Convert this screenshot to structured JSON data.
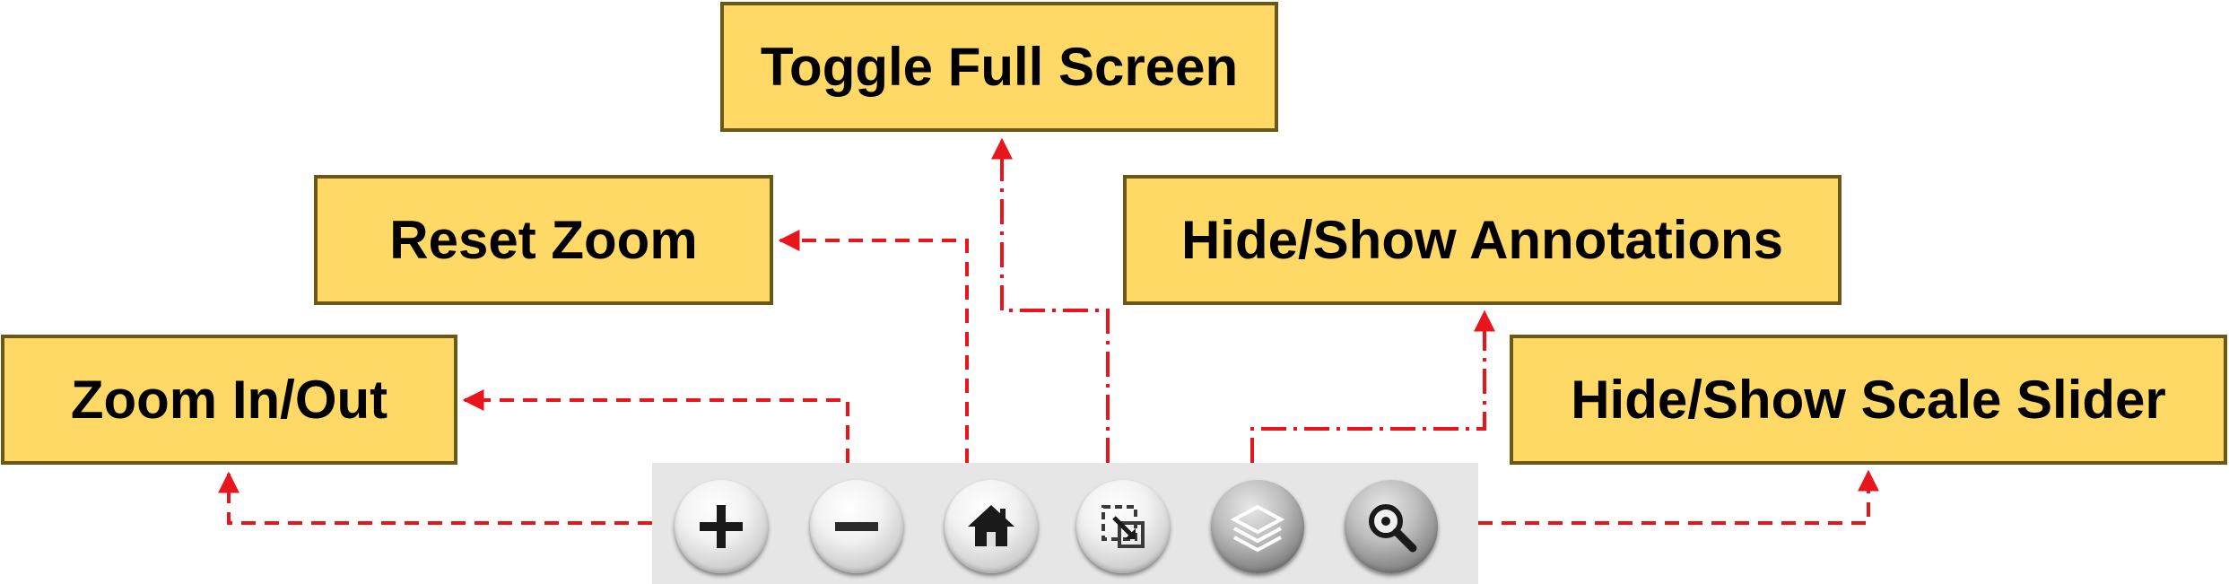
{
  "labels": {
    "toggle_full_screen": "Toggle Full Screen",
    "reset_zoom": "Reset Zoom",
    "hide_show_annotations": "Hide/Show Annotations",
    "zoom_in_out": "Zoom In/Out",
    "hide_show_scale_slider": "Hide/Show Scale Slider"
  },
  "toolbar": {
    "buttons": [
      {
        "icon": "plus-icon"
      },
      {
        "icon": "minus-icon"
      },
      {
        "icon": "home-icon"
      },
      {
        "icon": "fullscreen-icon"
      },
      {
        "icon": "layers-icon"
      },
      {
        "icon": "magnifier-icon"
      }
    ]
  },
  "colors": {
    "label_fill": "#ffd966",
    "label_border": "#6b5718",
    "connector": "#e8161c",
    "toolbar_bg": "#e6e6e6"
  }
}
